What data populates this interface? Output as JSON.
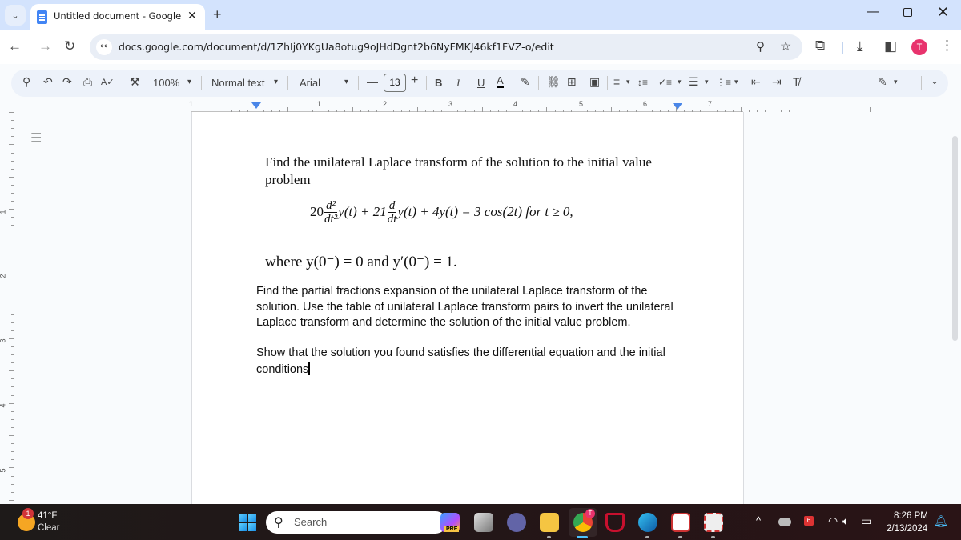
{
  "browser": {
    "tab_title": "Untitled document - Google Do",
    "tab_close": "✕",
    "new_tab": "+",
    "tab_menu": "⌄",
    "window": {
      "minimize": "—",
      "close": "✕"
    },
    "nav": {
      "back": "←",
      "forward": "→",
      "reload": "↻"
    },
    "url": "docs.google.com/document/d/1ZhIj0YKgUa8otug9oJHdDgnt2b6NyFMKJ46kf1FVZ-o/edit",
    "site_info_icon": "⚯",
    "zoom_icon": "⚲",
    "star_icon": "☆",
    "extensions_icon": "⧉",
    "downloads_icon": "⤓",
    "sidepanel_icon": "◧",
    "profile_initial": "T",
    "menu_icon": "⋮"
  },
  "toolbar": {
    "search": "⚲",
    "undo": "↶",
    "redo": "↷",
    "print": "⎙",
    "spellcheck": "A✓",
    "paint_format": "⚒",
    "zoom": "100%",
    "style": "Normal text",
    "font": "Arial",
    "font_size": "13",
    "decrease": "—",
    "increase": "+",
    "bold": "B",
    "italic": "I",
    "underline": "U",
    "text_color": "A",
    "highlight": "✎",
    "link": "⛓",
    "comment": "⊞",
    "image": "▣",
    "align": "≡",
    "line_spacing": "↕≡",
    "checklist": "✓≡",
    "bullets": "☰",
    "numbered": "⋮≡",
    "decrease_indent": "⇤",
    "increase_indent": "⇥",
    "clear_format": "T̸",
    "editing": "✎",
    "collapse": "⌄",
    "dropdown": "▾"
  },
  "ruler": {
    "horizontal": [
      "1",
      "1",
      "2",
      "3",
      "4",
      "5",
      "6",
      "7"
    ],
    "vertical": [
      "1",
      "2",
      "3",
      "4",
      "5"
    ]
  },
  "document": {
    "p1": "Find the unilateral Laplace transform of the solution to the initial value problem",
    "equation": {
      "coef1": "20",
      "d2": "d²",
      "dt2": "dt²",
      "y1": "y(t) + 21",
      "d": "d",
      "dt": "dt",
      "rest": "y(t) + 4y(t) = 3 cos(2t)  for  t ≥ 0,"
    },
    "where": "where y(0⁻) = 0 and y′(0⁻) = 1.",
    "p2": "Find the partial fractions expansion of the unilateral Laplace transform of the solution. Use the table of unilateral Laplace transform pairs to invert the unilateral Laplace transform and determine the solution of the initial value problem.",
    "p3": "Show that the solution you found satisfies the differential equation and the initial conditions"
  },
  "taskbar": {
    "weather_badge": "1",
    "temperature": "41°F",
    "condition": "Clear",
    "search_label": "Search",
    "search_icon": "⚲",
    "time": "8:26 PM",
    "date": "2/13/2024",
    "tray_chevron": "^",
    "wifi": "◠",
    "volume": "🔈︎",
    "battery": "▭",
    "notifications": "🔔︎",
    "copilot_badge": "PRE",
    "chrome_badge": "T"
  }
}
